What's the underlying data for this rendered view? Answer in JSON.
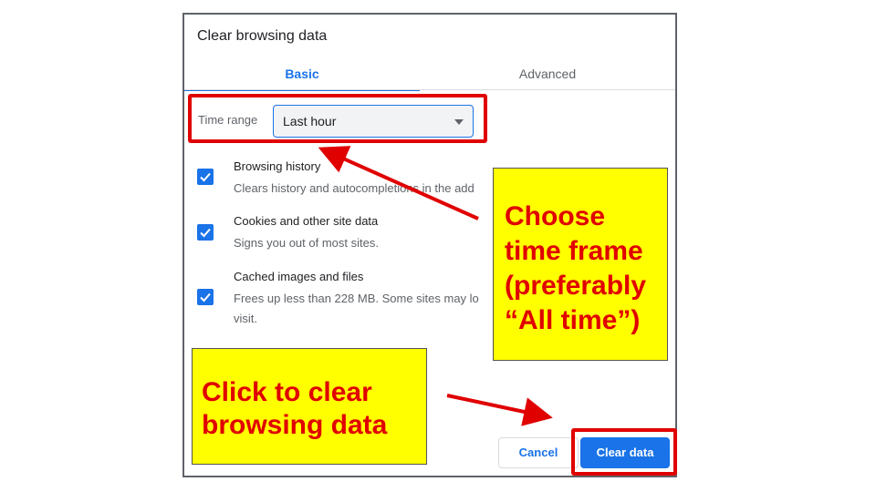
{
  "dialog": {
    "title": "Clear browsing data",
    "tabs": [
      {
        "label": "Basic",
        "active": true
      },
      {
        "label": "Advanced",
        "active": false
      }
    ],
    "time_range": {
      "label": "Time range",
      "selected": "Last hour"
    },
    "options": [
      {
        "title": "Browsing history",
        "desc_lines": [
          "Clears history and autocompletions in the add"
        ],
        "checked": true
      },
      {
        "title": "Cookies and other site data",
        "desc_lines": [
          "Signs you out of most sites."
        ],
        "checked": true
      },
      {
        "title": "Cached images and files",
        "desc_lines": [
          "Frees up less than 228 MB. Some sites may lo",
          "visit."
        ],
        "checked": true
      }
    ],
    "buttons": {
      "cancel": "Cancel",
      "clear": "Clear data"
    }
  },
  "annotations": {
    "callout_time_frame": [
      "Choose",
      "time frame",
      "(preferably",
      "“All time”)"
    ],
    "callout_clear": [
      "Click to clear",
      "browsing data"
    ]
  },
  "colors": {
    "accent": "#1a73e8",
    "highlight_red": "#e00000",
    "callout_yellow": "#ffff00"
  },
  "icons": {
    "checkbox": "check-icon",
    "dropdown": "caret-down-icon"
  }
}
